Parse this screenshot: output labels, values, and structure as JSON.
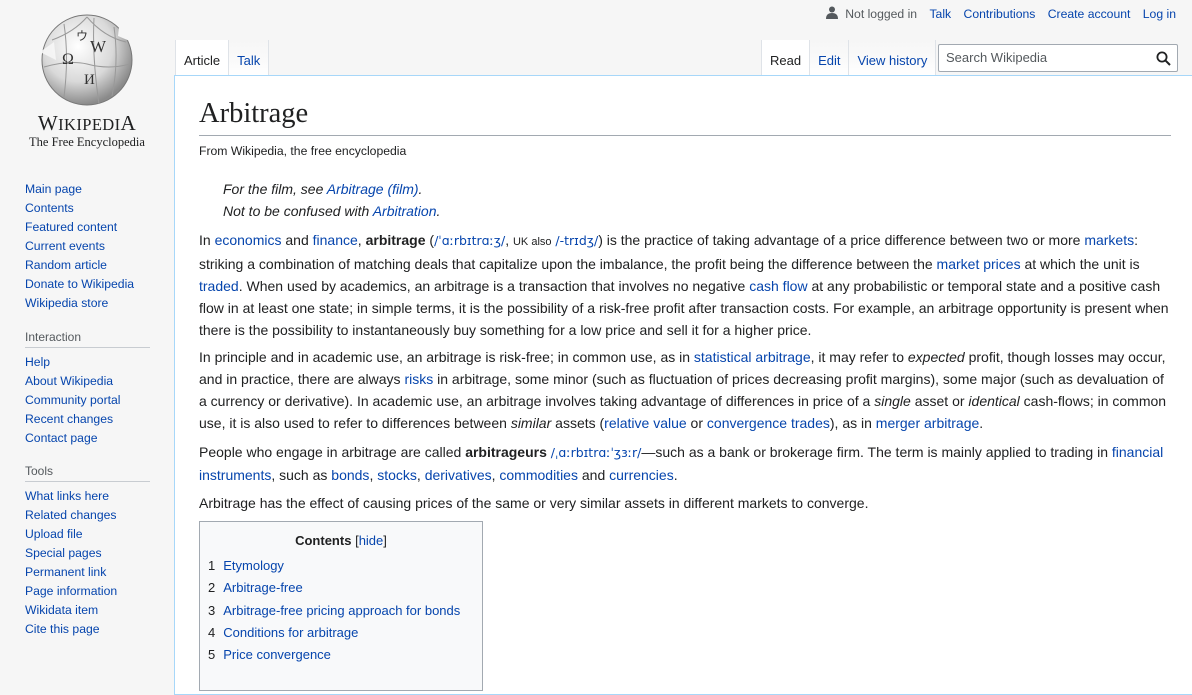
{
  "logo": {
    "wordmark_first": "W",
    "wordmark_rest": "IKIPEDI",
    "wordmark_last": "A",
    "tagline": "The Free Encyclopedia",
    "globe_glyphs": [
      "W",
      "Ω",
      "И",
      "ウ"
    ]
  },
  "personal_tools": {
    "icon": "user-icon",
    "not_logged_in": "Not logged in",
    "talk": "Talk",
    "contributions": "Contributions",
    "create_account": "Create account",
    "log_in": "Log in"
  },
  "tabs_left": [
    {
      "label": "Article",
      "selected": true
    },
    {
      "label": "Talk",
      "selected": false
    }
  ],
  "tabs_right": [
    {
      "label": "Read",
      "selected": true
    },
    {
      "label": "Edit",
      "selected": false
    },
    {
      "label": "View history",
      "selected": false
    }
  ],
  "search": {
    "placeholder": "Search Wikipedia",
    "value": "",
    "icon": "search-icon"
  },
  "sidebar": {
    "navigation": [
      "Main page",
      "Contents",
      "Featured content",
      "Current events",
      "Random article",
      "Donate to Wikipedia",
      "Wikipedia store"
    ],
    "interaction_heading": "Interaction",
    "interaction": [
      "Help",
      "About Wikipedia",
      "Community portal",
      "Recent changes",
      "Contact page"
    ],
    "tools_heading": "Tools",
    "tools": [
      "What links here",
      "Related changes",
      "Upload file",
      "Special pages",
      "Permanent link",
      "Page information",
      "Wikidata item",
      "Cite this page"
    ]
  },
  "article": {
    "title": "Arbitrage",
    "site_sub": "From Wikipedia, the free encyclopedia",
    "hatnote1": {
      "text": "For the film, see ",
      "link": "Arbitrage (film)",
      "end": "."
    },
    "hatnote2": {
      "text": "Not to be confused with ",
      "link": "Arbitration",
      "end": "."
    },
    "p1": {
      "t1": "In ",
      "l_economics": "economics",
      "t2": " and ",
      "l_finance": "finance",
      "t3": ", ",
      "bold": "arbitrage",
      "t4": " (",
      "ipa1": "/ˈɑːrbɪtrɑːʒ/",
      "t5": ", ",
      "uk": "UK also",
      "t6": " ",
      "ipa2": "/-trɪdʒ/",
      "t7": ") is the practice of taking advantage of a price difference between two or more ",
      "l_markets": "markets",
      "t8": ": striking a combination of matching deals that capitalize upon the imbalance, the profit being the difference between the ",
      "l_market_prices": "market prices",
      "t9": " at which the unit is ",
      "l_traded": "traded",
      "t10": ". When used by academics, an arbitrage is a transaction that involves no negative ",
      "l_cash_flow": "cash flow",
      "t11": " at any probabilistic or temporal state and a positive cash flow in at least one state; in simple terms, it is the possibility of a risk-free profit after transaction costs. For example, an arbitrage opportunity is present when there is the possibility to instantaneously buy something for a low price and sell it for a higher price."
    },
    "p2": {
      "t1": "In principle and in academic use, an arbitrage is risk-free; in common use, as in ",
      "l_stat_arb": "statistical arbitrage",
      "t2": ", it may refer to ",
      "em1": "expected",
      "t3": " profit, though losses may occur, and in practice, there are always ",
      "l_risks": "risks",
      "t4": " in arbitrage, some minor (such as fluctuation of prices decreasing profit margins), some major (such as devaluation of a currency or derivative). In academic use, an arbitrage involves taking advantage of differences in price of a ",
      "em2": "single",
      "t5": " asset or ",
      "em3": "identical",
      "t6": " cash-flows; in common use, it is also used to refer to differences between ",
      "em4": "similar",
      "t7": " assets (",
      "l_relative_value": "relative value",
      "t8": " or ",
      "l_convergence": "convergence trades",
      "t9": "), as in ",
      "l_merger": "merger arbitrage",
      "t10": "."
    },
    "p3": {
      "t1": "People who engage in arbitrage are called ",
      "bold": "arbitrageurs",
      "t2": " ",
      "ipa": "/ˌɑːrbɪtrɑːˈʒɜːr/",
      "t3": "—such as a bank or brokerage firm. The term is mainly applied to trading in ",
      "l_fin_instr": "financial instruments",
      "t4": ", such as ",
      "l_bonds": "bonds",
      "t5": ", ",
      "l_stocks": "stocks",
      "t6": ", ",
      "l_derivatives": "derivatives",
      "t7": ", ",
      "l_commodities": "commodities",
      "t8": " and ",
      "l_currencies": "currencies",
      "t9": "."
    },
    "p4": "Arbitrage has the effect of causing prices of the same or very similar assets in different markets to converge."
  },
  "toc": {
    "title": "Contents",
    "toggle_open": "[",
    "toggle_label": "hide",
    "toggle_close": "]",
    "items": [
      {
        "num": "1",
        "label": "Etymology"
      },
      {
        "num": "2",
        "label": "Arbitrage-free"
      },
      {
        "num": "3",
        "label": "Arbitrage-free pricing approach for bonds"
      },
      {
        "num": "4",
        "label": "Conditions for arbitrage"
      },
      {
        "num": "5",
        "label": "Price convergence"
      }
    ]
  }
}
